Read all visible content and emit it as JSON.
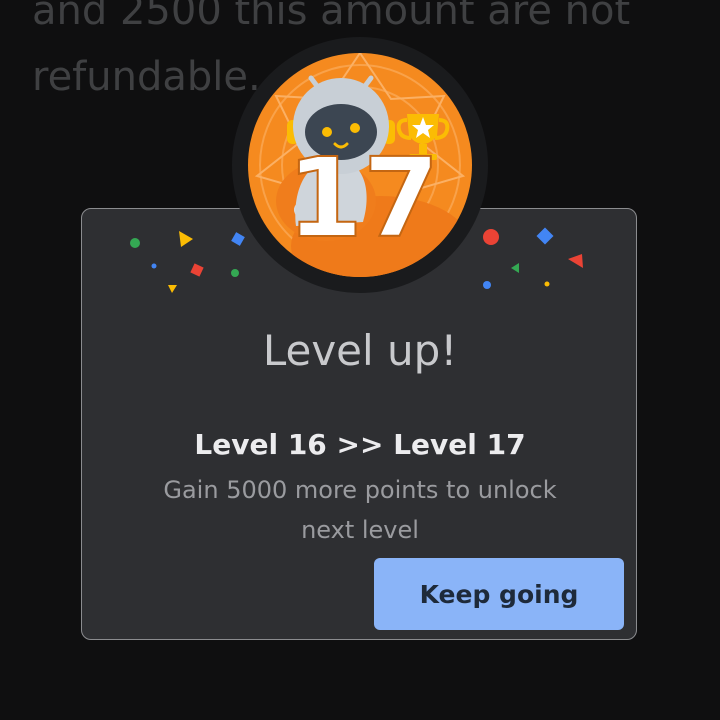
{
  "background": {
    "lines": [
      "and 2500 this amount are not",
      "refundable."
    ]
  },
  "dialog": {
    "headline": "Level up!",
    "level_change": "Level 16 >> Level 17",
    "message": "Gain 5000 more points to unlock next level",
    "primary_button": "Keep going"
  },
  "badge": {
    "level_number": "17",
    "icon": "robot-mascot-with-trophy-icon",
    "color": "#f58a1f"
  },
  "colors": {
    "background": "#0f0f10",
    "dialog": "#2e2f32",
    "accent": "#8ab4f8"
  }
}
